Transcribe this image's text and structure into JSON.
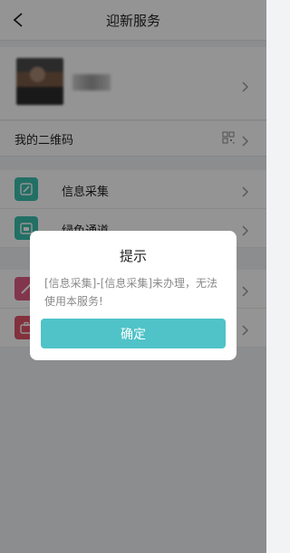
{
  "header": {
    "title": "迎新服务",
    "back_icon": "back-chevron-icon"
  },
  "profile": {
    "avatar": "blurred-avatar",
    "name": ""
  },
  "qr_row": {
    "label": "我的二维码",
    "icon": "qr-code-icon"
  },
  "menu": [
    {
      "label": "信息采集",
      "icon": "edit-icon",
      "color": "#3bbfae"
    },
    {
      "label": "绿色通道",
      "icon": "calendar-icon",
      "color": "#3bbfae"
    },
    {
      "label": "",
      "icon": "edit-icon",
      "color": "#e05d86"
    },
    {
      "label": "",
      "icon": "briefcase-icon",
      "color": "#e0556a"
    }
  ],
  "dialog": {
    "title": "提示",
    "message": "[信息采集]-[信息采集]未办理，无法使用本服务!",
    "confirm_label": "确定",
    "button_color": "#4fc3c7"
  },
  "colors": {
    "accent": "#4fc3c7",
    "overlay": "rgba(0,0,0,0.42)"
  }
}
